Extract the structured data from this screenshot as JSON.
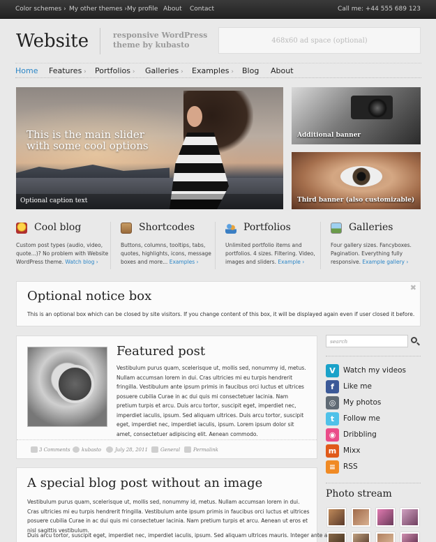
{
  "topbar": {
    "items": [
      "Color schemes ›",
      "My other themes ›",
      "My profile",
      "About",
      "Contact"
    ],
    "phone": "Call me: +44 555 689 123"
  },
  "header": {
    "logo": "Website",
    "tagline": "responsive WordPress theme by kubasto",
    "ad_space": "468x60 ad space (optional)"
  },
  "nav": {
    "items": [
      "Home",
      "Features",
      "Portfolios",
      "Galleries",
      "Examples",
      "Blog",
      "About"
    ]
  },
  "slider": {
    "caption": "This is the main slider with some cool options",
    "small_caption": "Optional caption text",
    "slides": 5,
    "active_slide": 1
  },
  "banners": {
    "banner1": "Additional banner",
    "banner2": "Third banner (also customizable)"
  },
  "features": [
    {
      "title": "Cool blog",
      "desc": "Custom post types (audio, video, quote...)? No problem with Website WordPress theme.",
      "link": "Watch blog ›",
      "color": "#d4a017"
    },
    {
      "title": "Shortcodes",
      "desc": "Buttons, columns, tooltips, tabs, quotes, highlights, icons, message boxes and more...",
      "link": "Examples ›",
      "color": "#b58a57"
    },
    {
      "title": "Portfolios",
      "desc": "Unlimited portfolio items and portfolios. 4 sizes. Filtering. Video, images and sliders.",
      "link": "Example ›",
      "color": "#3b7fc4"
    },
    {
      "title": "Galleries",
      "desc": "Four gallery sizes. Fancyboxes. Pagination. Everything fully responsive.",
      "link": "Example gallery ›",
      "color": "#6a9b4a"
    }
  ],
  "notice": {
    "title": "Optional notice box",
    "text": "This is an optional box which can be closed by site visitors. If you change content of this box, it will be displayed again even if user closed it before.",
    "close": "✖"
  },
  "post": {
    "title": "Featured post",
    "text": "Vestibulum purus quam, scelerisque ut, mollis sed, nonummy id, metus. Nullam accumsan lorem in dui. Cras ultricies mi eu turpis hendrerit fringilla. Vestibulum ante ipsum primis in faucibus orci luctus et ultrices posuere cubilia Curae in ac dui quis mi consectetuer lacinia. Nam pretium turpis et arcu. Duis arcu tortor, suscipit eget, imperdiet nec, imperdiet iaculis, ipsum. Sed aliquam ultrices. Duis arcu tortor, suscipit eget, imperdiet nec, imperdiet iaculis, ipsum. Lorem ipsum dolor sit amet, consectetuer adipiscing elit. Aenean commodo.",
    "meta": {
      "comments": "3 Comments",
      "author": "kubasto",
      "date": "July 28, 2011",
      "category": "General",
      "permalink": "Permalink"
    }
  },
  "post2": {
    "title": "A special blog post without an image",
    "text": "Vestibulum purus quam, scelerisque ut, mollis sed, nonummy id, metus. Nullam accumsan lorem in dui. Cras ultricies mi eu turpis hendrerit fringilla. Vestibulum ante ipsum primis in faucibus orci luctus et ultrices posuere cubilia Curae in ac dui quis mi consectetuer lacinia. Nam pretium turpis et arcu. Aenean ut eros et nisl sagittis vestibulum.",
    "text2": "Duis arcu tortor, suscipit eget, imperdiet nec, imperdiet iaculis, ipsum. Sed aliquam ultrices mauris. Integer ante arcu,"
  },
  "sidebar": {
    "search_placeholder": "search",
    "social": [
      {
        "icon": "V",
        "label": "Watch my videos",
        "color": "#1aa2c9"
      },
      {
        "icon": "f",
        "label": "Like me",
        "color": "#3b5998"
      },
      {
        "icon": "◎",
        "label": "My photos",
        "color": "#5f6a74"
      },
      {
        "icon": "t",
        "label": "Follow me",
        "color": "#4fc1e9"
      },
      {
        "icon": "◉",
        "label": "Dribbling",
        "color": "#ea4c89"
      },
      {
        "icon": "m",
        "label": "Mixx",
        "color": "#e05a1a"
      },
      {
        "icon": "≡",
        "label": "RSS",
        "color": "#f08a24"
      }
    ],
    "photostream_title": "Photo stream"
  }
}
